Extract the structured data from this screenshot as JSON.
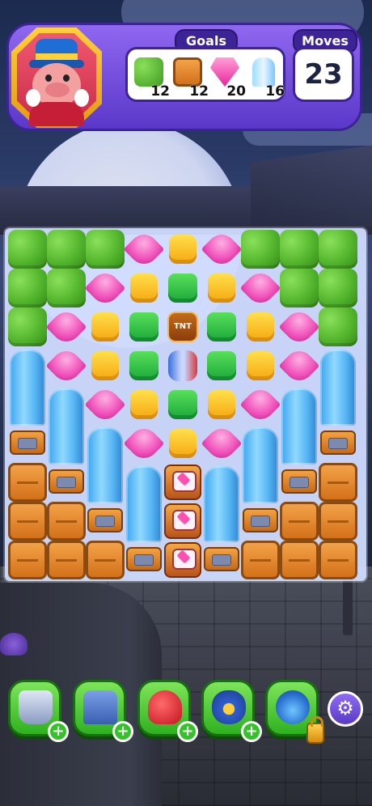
{
  "hud": {
    "goals_label": "Goals",
    "moves_label": "Moves",
    "moves_value": "23",
    "goals": [
      {
        "name": "leaf",
        "count": "12"
      },
      {
        "name": "crate",
        "count": "12"
      },
      {
        "name": "pink-gem",
        "count": "20"
      },
      {
        "name": "crystal",
        "count": "16"
      }
    ]
  },
  "board": {
    "cols": 9,
    "rows": 9,
    "layout": [
      [
        "leaf",
        "leaf",
        "leaf",
        "pink",
        "yellow",
        "pink",
        "leaf",
        "leaf",
        "leaf"
      ],
      [
        "leaf",
        "leaf",
        "pink",
        "yellow",
        "green",
        "yellow",
        "pink",
        "leaf",
        "leaf"
      ],
      [
        "leaf",
        "pink",
        "yellow",
        "green",
        "tnt",
        "green",
        "yellow",
        "pink",
        "leaf"
      ],
      [
        "pillar",
        "pink",
        "yellow",
        "green",
        "rocket",
        "green",
        "yellow",
        "pink",
        "pillar"
      ],
      [
        "pillar",
        "pillar",
        "pink",
        "yellow",
        "green",
        "yellow",
        "pink",
        "pillar",
        "pillar"
      ],
      [
        "base",
        "pillar",
        "pillar",
        "pink",
        "yellow",
        "pink",
        "pillar",
        "pillar",
        "base"
      ],
      [
        "crate",
        "base",
        "pillar",
        "pillar",
        "machine",
        "pillar",
        "pillar",
        "base",
        "crate"
      ],
      [
        "crate",
        "crate",
        "base",
        "pillar",
        "machine",
        "pillar",
        "base",
        "crate",
        "crate"
      ],
      [
        "crate",
        "crate",
        "crate",
        "base",
        "machine",
        "base",
        "crate",
        "crate",
        "crate"
      ]
    ]
  },
  "boosters": [
    {
      "name": "hammer-booster",
      "state": "add"
    },
    {
      "name": "train-booster",
      "state": "add"
    },
    {
      "name": "boxing-glove-booster",
      "state": "add"
    },
    {
      "name": "magic-pot-booster",
      "state": "add"
    },
    {
      "name": "propeller-booster",
      "state": "locked"
    }
  ],
  "settings_icon": "gear-icon",
  "colors": {
    "hud_purple": "#7a52e4",
    "booster_green": "#4cc23a",
    "board_bg": "#d0dcff"
  }
}
